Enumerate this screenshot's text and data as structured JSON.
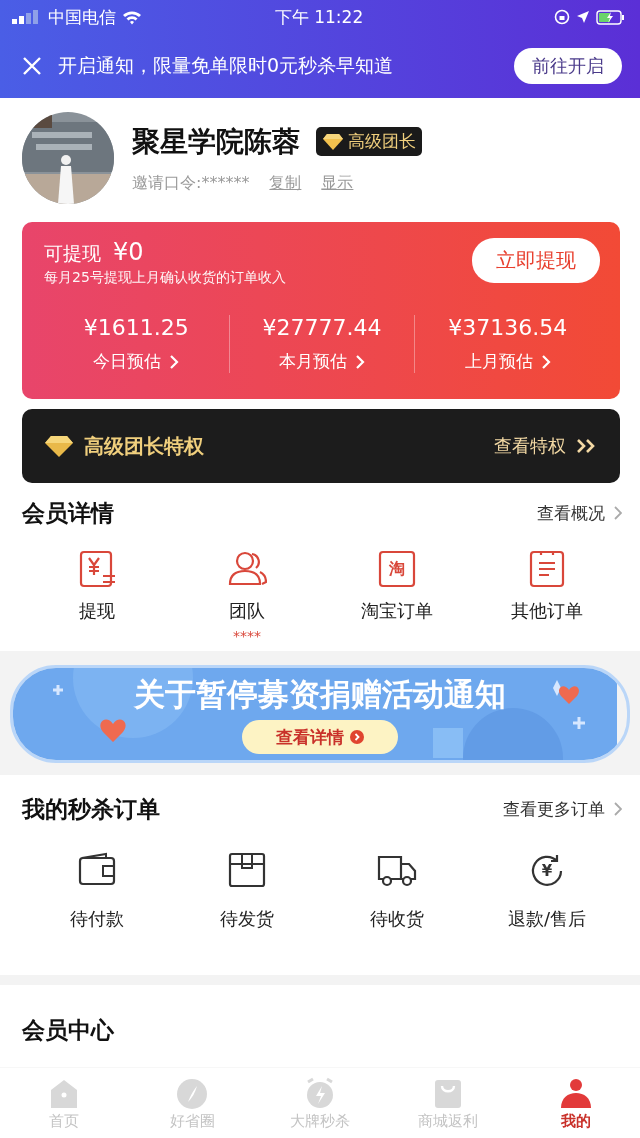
{
  "status_bar": {
    "carrier": "中国电信",
    "time": "下午 11:22"
  },
  "notice": {
    "text": "开启通知，限量免单限时0元秒杀早知道",
    "button": "前往开启"
  },
  "profile": {
    "name": "聚星学院陈蓉",
    "badge": "高级团长",
    "invite_label": "邀请口令:******",
    "copy": "复制",
    "show": "显示"
  },
  "earnings": {
    "label": "可提现",
    "amount": "¥0",
    "note": "每月25号提现上月确认收货的订单收入",
    "button": "立即提现",
    "stats": [
      {
        "value": "¥1611.25",
        "label": "今日预估"
      },
      {
        "value": "¥27777.44",
        "label": "本月预估"
      },
      {
        "value": "¥37136.54",
        "label": "上月预估"
      }
    ]
  },
  "privilege": {
    "title": "高级团长特权",
    "link": "查看特权"
  },
  "member_details": {
    "title": "会员详情",
    "link": "查看概况",
    "items": [
      {
        "kind": "withdraw",
        "label": "提现"
      },
      {
        "kind": "team",
        "label": "团队",
        "sub": "****"
      },
      {
        "kind": "taobao",
        "label": "淘宝订单",
        "glyph": "淘"
      },
      {
        "kind": "other",
        "label": "其他订单"
      }
    ]
  },
  "banner": {
    "title": "关于暂停募资捐赠活动通知",
    "button": "查看详情"
  },
  "orders": {
    "title": "我的秒杀订单",
    "link": "查看更多订单",
    "items": [
      {
        "kind": "wallet",
        "label": "待付款"
      },
      {
        "kind": "box",
        "label": "待发货"
      },
      {
        "kind": "truck",
        "label": "待收货"
      },
      {
        "kind": "refund",
        "label": "退款/售后",
        "glyph": "¥"
      }
    ]
  },
  "member_center": {
    "title": "会员中心"
  },
  "tab_bar": [
    {
      "kind": "home",
      "label": "首页",
      "selected": false
    },
    {
      "kind": "compass",
      "label": "好省圈",
      "selected": false
    },
    {
      "kind": "alarm",
      "label": "大牌秒杀",
      "selected": false
    },
    {
      "kind": "bag",
      "label": "商城返利",
      "selected": false
    },
    {
      "kind": "me",
      "label": "我的",
      "selected": true
    }
  ]
}
